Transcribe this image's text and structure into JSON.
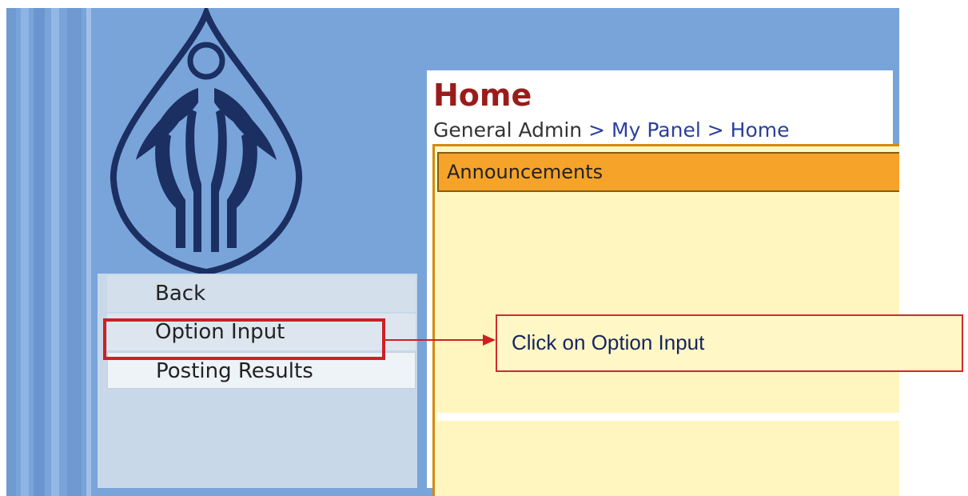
{
  "page": {
    "title": "Home",
    "breadcrumb": {
      "root": "General Admin",
      "separator": ">",
      "items": [
        "My Panel",
        "Home"
      ]
    }
  },
  "sidebar": {
    "menu": [
      {
        "label": "Back"
      },
      {
        "label": "Option Input"
      },
      {
        "label": "Posting Results"
      }
    ]
  },
  "announcements": {
    "header": "Announcements"
  },
  "annotation": {
    "callout_text": "Click on Option Input",
    "highlight_color": "#cf1f25"
  },
  "colors": {
    "title": "#9b1b1b",
    "breadcrumb_link": "#2a3f9e",
    "background_blue": "#79a4da",
    "announcement_header": "#f6a32a",
    "announcement_body": "#fff6bf"
  },
  "icons": [
    "logo-icon",
    "arrow-icon"
  ]
}
